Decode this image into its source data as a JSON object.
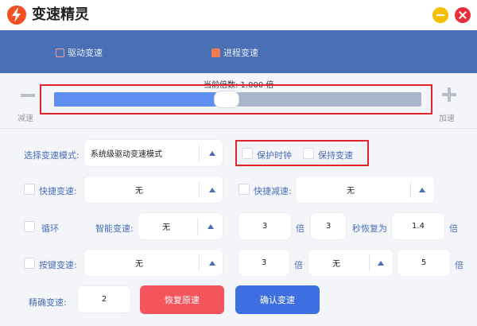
{
  "app": {
    "title": "变速精灵"
  },
  "tabs": [
    {
      "label": "驱动变速"
    },
    {
      "label": "进程变速"
    }
  ],
  "speed": {
    "readout": "当前倍数: 1.000 倍",
    "minus_label": "减速",
    "plus_label": "加速",
    "slider_position_percent": 47
  },
  "mode": {
    "label": "选择变速模式:",
    "value": "系统级驱动变速模式"
  },
  "options": {
    "protect_clock": "保护时钟",
    "keep_speed": "保持变速"
  },
  "quick_speedup": {
    "label": "快捷变速:",
    "value": "无"
  },
  "quick_slowdown": {
    "label": "快捷减速:",
    "value": "无"
  },
  "loop": {
    "label": "循环",
    "smart_label": "智能变速:",
    "smart_value": "无",
    "multiplier": "3",
    "multiplier_unit": "倍",
    "seconds": "3",
    "restore_label": "秒恢复为",
    "restore_value": "1.4",
    "restore_unit": "倍"
  },
  "key_speed": {
    "label": "按键变速:",
    "value": "无",
    "multiplier": "3",
    "multiplier_unit": "倍",
    "second_key": "无",
    "second_value": "5",
    "second_unit": "倍"
  },
  "precise": {
    "label": "精确变速:",
    "value": "2"
  },
  "buttons": {
    "reset": "恢复原速",
    "confirm": "确认变速"
  },
  "colors": {
    "accent": "#4a6fb5",
    "slider_fill": "#5d8ef0",
    "reset": "#f4545c",
    "confirm": "#3e6fe0",
    "highlight": "#e0242c"
  }
}
